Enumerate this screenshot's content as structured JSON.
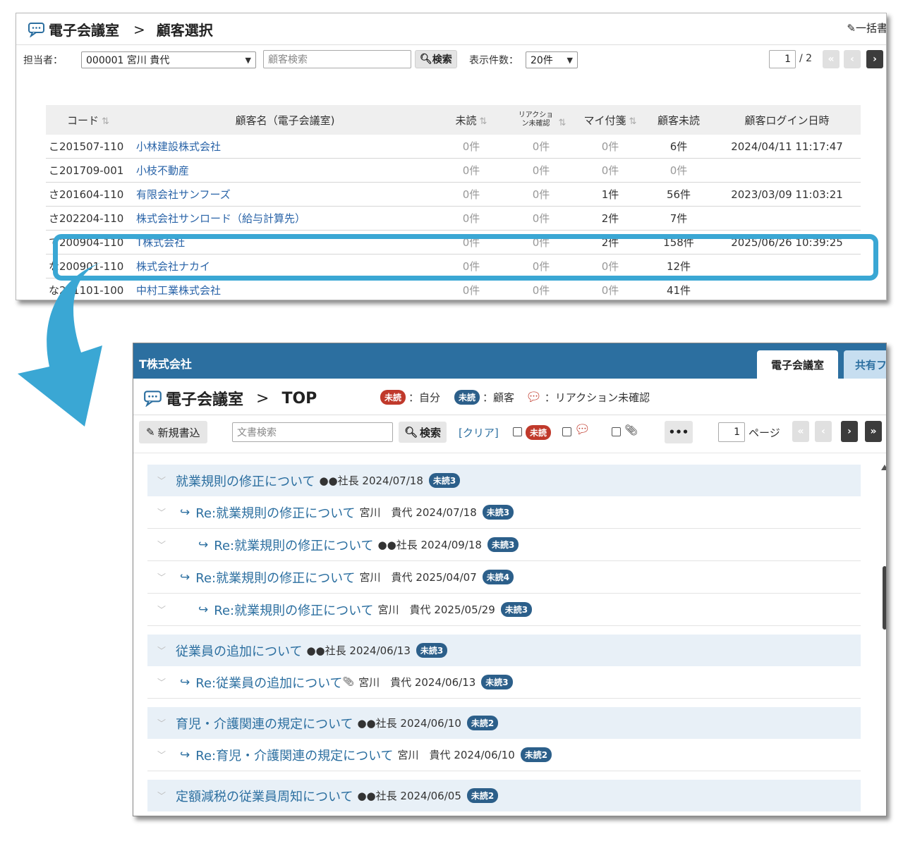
{
  "customer_window": {
    "title": "電子会議室",
    "separator": ">",
    "subtitle": "顧客選択",
    "bulk_label": "一括書",
    "filter": {
      "owner_label": "担当者：",
      "owner_value": "000001 宮川 貴代",
      "search_placeholder": "顧客検索",
      "search_button": "検索",
      "page_size_label": "表示件数：",
      "page_size_value": "20件",
      "page_current": "1",
      "page_total": "/ 2"
    },
    "columns": [
      "コード",
      "顧客名（電子会議室)",
      "未読",
      "リアクション未確認",
      "マイ付箋",
      "顧客未読",
      "顧客ログイン日時"
    ],
    "rows": [
      {
        "code": "こ201507-110",
        "name": "小林建設株式会社",
        "unread": "0件",
        "reaction": "0件",
        "sticky": "0件",
        "cust_unread": "6件",
        "login": "2024/04/11 11:17:47"
      },
      {
        "code": "こ201709-001",
        "name": "小枝不動産",
        "unread": "0件",
        "reaction": "0件",
        "sticky": "0件",
        "cust_unread": "0件",
        "login": ""
      },
      {
        "code": "さ201604-110",
        "name": "有限会社サンフーズ",
        "unread": "0件",
        "reaction": "0件",
        "sticky": "1件",
        "cust_unread": "56件",
        "login": "2023/03/09 11:03:21"
      },
      {
        "code": "さ202204-110",
        "name": "株式会社サンロード（給与計算先）",
        "unread": "0件",
        "reaction": "0件",
        "sticky": "2件",
        "cust_unread": "7件",
        "login": ""
      },
      {
        "code": "て200904-110",
        "name": "T株式会社",
        "unread": "0件",
        "reaction": "0件",
        "sticky": "2件",
        "cust_unread": "158件",
        "login": "2025/06/26 10:39:25"
      },
      {
        "code": "な200901-110",
        "name": "株式会社ナカイ",
        "unread": "0件",
        "reaction": "0件",
        "sticky": "0件",
        "cust_unread": "12件",
        "login": ""
      },
      {
        "code": "な201101-100",
        "name": "中村工業株式会社",
        "unread": "0件",
        "reaction": "0件",
        "sticky": "0件",
        "cust_unread": "41件",
        "login": ""
      }
    ]
  },
  "room_window": {
    "company": "T株式会社",
    "tabs": [
      "電子会議室",
      "共有フ"
    ],
    "title": "電子会議室",
    "separator": ">",
    "subtitle": "TOP",
    "legend": {
      "unread_badge": "未読",
      "self_label": "：自分",
      "customer_label": "：顧客",
      "reaction_label": "：リアクション未確認"
    },
    "toolbar": {
      "new_post": "新規書込",
      "doc_search_placeholder": "文書検索",
      "search_button": "検索",
      "clear_link": "[クリア]",
      "page_value": "1",
      "page_suffix": "ページ"
    },
    "threads": [
      {
        "level": 0,
        "subject": "就業規則の修正について",
        "meta": "●●社長 2024/07/18",
        "badge": "未読3"
      },
      {
        "level": 1,
        "subject": "Re:就業規則の修正について",
        "meta": "宮川　貴代 2024/07/18",
        "badge": "未読3"
      },
      {
        "level": 2,
        "subject": "Re:就業規則の修正について",
        "meta": "●●社長 2024/09/18",
        "badge": "未読3"
      },
      {
        "level": 1,
        "subject": "Re:就業規則の修正について",
        "meta": "宮川　貴代 2025/04/07",
        "badge": "未読4"
      },
      {
        "level": 2,
        "subject": "Re:就業規則の修正について",
        "meta": "宮川　貴代 2025/05/29",
        "badge": "未読3"
      },
      {
        "level": 0,
        "subject": "従業員の追加について",
        "meta": "●●社長 2024/06/13",
        "badge": "未読3"
      },
      {
        "level": 1,
        "subject": "Re:従業員の追加について",
        "meta": "宮川　貴代 2024/06/13",
        "badge": "未読3",
        "attach": true
      },
      {
        "level": 0,
        "subject": "育児・介護関連の規定について",
        "meta": "●●社長 2024/06/10",
        "badge": "未読2"
      },
      {
        "level": 1,
        "subject": "Re:育児・介護関連の規定について",
        "meta": "宮川　貴代 2024/06/10",
        "badge": "未読2"
      },
      {
        "level": 0,
        "subject": "定額減税の従業員周知について",
        "meta": "●●社長 2024/06/05",
        "badge": "未読2"
      }
    ]
  },
  "colors": {
    "link": "#2a64a8",
    "header_bar": "#2c6fa0",
    "highlight": "#3aa7d4",
    "unread_red": "#c0392b",
    "unread_blue": "#2c5f8a"
  }
}
